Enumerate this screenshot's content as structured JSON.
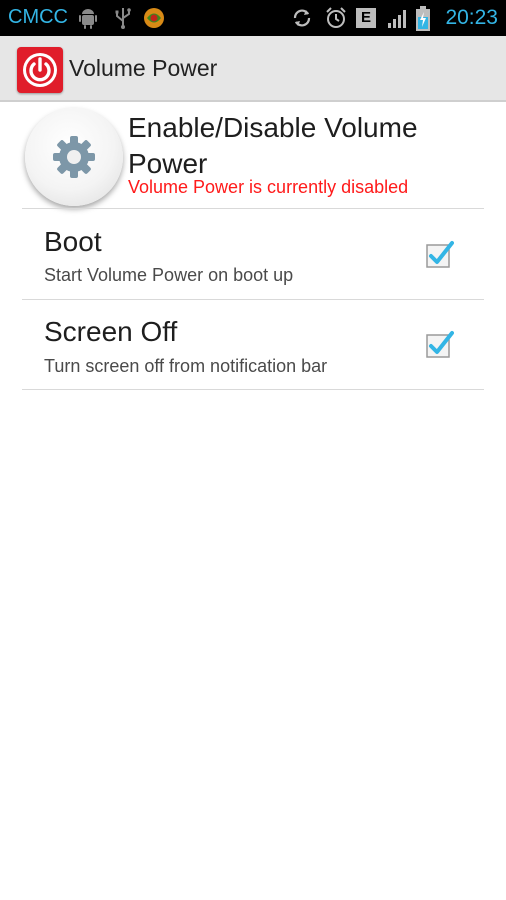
{
  "status_bar": {
    "carrier": "CMCC",
    "time": "20:23",
    "network_type": "E",
    "left_icons": [
      "android-icon",
      "usb-icon",
      "app-notification-icon"
    ],
    "right_icons": [
      "sync-icon",
      "alarm-icon",
      "network-type-icon",
      "signal-icon",
      "battery-charging-icon"
    ]
  },
  "action_bar": {
    "app_icon": "power-icon",
    "title": "Volume Power"
  },
  "master": {
    "icon": "gear-icon",
    "title": "Enable/Disable Volume Power",
    "status": "Volume Power is currently disabled",
    "status_color": "#ff1a1a"
  },
  "preferences": [
    {
      "title": "Boot",
      "summary": "Start Volume Power on boot up",
      "checked": true
    },
    {
      "title": "Screen Off",
      "summary": "Turn screen off from notification bar",
      "checked": true
    }
  ],
  "colors": {
    "accent": "#33b5e5",
    "checkbox_blue": "#33b5e5",
    "app_icon_red": "#e01d2a"
  }
}
